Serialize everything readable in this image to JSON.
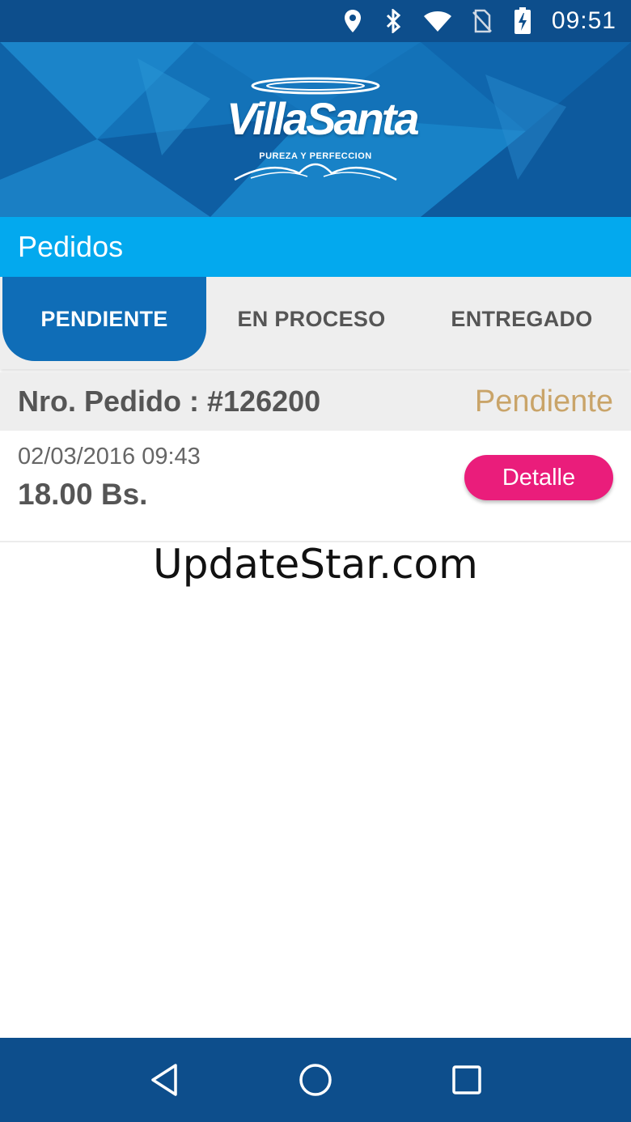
{
  "status_bar": {
    "time": "09:51",
    "icons": [
      "location-icon",
      "bluetooth-icon",
      "wifi-icon",
      "no-sim-icon",
      "battery-charging-icon"
    ]
  },
  "banner": {
    "logo_text": "VillaSanta",
    "logo_tagline": "PUREZA Y PERFECCION"
  },
  "header": {
    "title": "Pedidos"
  },
  "tabs": [
    {
      "label": "PENDIENTE",
      "active": true
    },
    {
      "label": "EN PROCESO",
      "active": false
    },
    {
      "label": "ENTREGADO",
      "active": false
    }
  ],
  "orders": [
    {
      "number_label": "Nro. Pedido : #126200",
      "status": "Pendiente",
      "datetime": "02/03/2016 09:43",
      "amount": "18.00 Bs.",
      "detail_label": "Detalle"
    }
  ],
  "watermark": "UpdateStar.com",
  "colors": {
    "status_bar": "#0d4e8c",
    "title_bar": "#03a9ee",
    "active_tab": "#0f6db7",
    "status_text": "#c9a469",
    "detail_button": "#ea1d7b"
  },
  "nav_bar": {
    "icons": [
      "back-icon",
      "home-icon",
      "recents-icon"
    ]
  }
}
